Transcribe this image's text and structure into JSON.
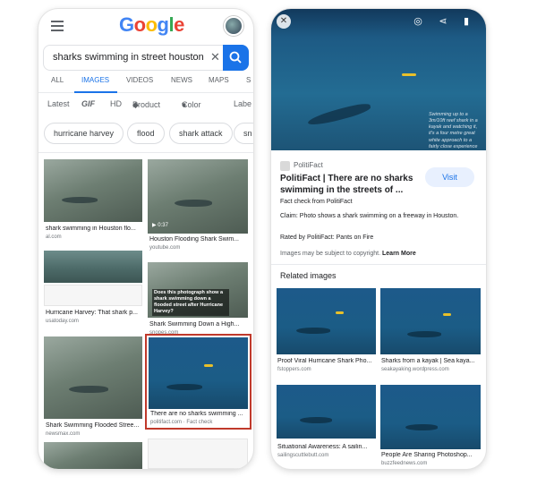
{
  "left": {
    "logo": [
      "G",
      "o",
      "o",
      "g",
      "l",
      "e"
    ],
    "logo_colors": [
      "#4285F4",
      "#EA4335",
      "#FBBC05",
      "#4285F4",
      "#34A853",
      "#EA4335"
    ],
    "search_query": "sharks swimming in street houston",
    "tabs": [
      "ALL",
      "IMAGES",
      "VIDEOS",
      "NEWS",
      "MAPS",
      "S"
    ],
    "active_tab": "IMAGES",
    "filters": [
      "Latest",
      "GIF",
      "HD",
      "Product",
      "Color",
      "Labe"
    ],
    "chips": [
      "hurricane harvey",
      "flood",
      "shark attack",
      "sn"
    ],
    "results": [
      {
        "caption": "shark swimming in Houston flo...",
        "source": "al.com"
      },
      {
        "caption": "Houston Flooding Shark Swim...",
        "source": "youtube.com",
        "duration": "0:37"
      },
      {
        "caption": "Hurricane Harvey: That shark p...",
        "source": "usatoday.com"
      },
      {
        "caption": "Shark Swimming Down a High...",
        "source": "snopes.com",
        "overlay": "Does this photograph show a shark swimming down a flooded street after Hurricane Harvey?"
      },
      {
        "caption": "Shark Swimming Flooded Stree...",
        "source": "newsmax.com"
      },
      {
        "caption": "There are no sharks swimming ...",
        "source": "politifact.com · Fact check"
      }
    ]
  },
  "right": {
    "hero_watermark": "Swimming up to a 3m/10ft reef shark in a kayak and watching it, it's a four metre great white approach to a fairly close experience",
    "publisher": "PolitiFact",
    "title": "PolitiFact | There are no sharks swimming in the streets of ...",
    "visit_label": "Visit",
    "fact_check": "Fact check from PolitiFact",
    "claim": "Claim: Photo shows a shark swimming on a freeway in Houston.",
    "rated": "Rated by PolitiFact: Pants on Fire",
    "copyright": "Images may be subject to copyright.",
    "learn_more": "Learn More",
    "related_heading": "Related images",
    "related": [
      {
        "caption": "Proof Viral Hurricane Shark Pho...",
        "source": "fstoppers.com"
      },
      {
        "caption": "Sharks from a kayak | Sea kaya...",
        "source": "seakayaking.wordpress.com"
      },
      {
        "caption": "Situational Awareness: A sailin...",
        "source": "sailingscuttlebutt.com"
      },
      {
        "caption": "People Are Sharing Photoshop...",
        "source": "buzzfeednews.com"
      }
    ]
  },
  "colors": {
    "accent": "#1a73e8",
    "highlight": "#c0392b"
  }
}
